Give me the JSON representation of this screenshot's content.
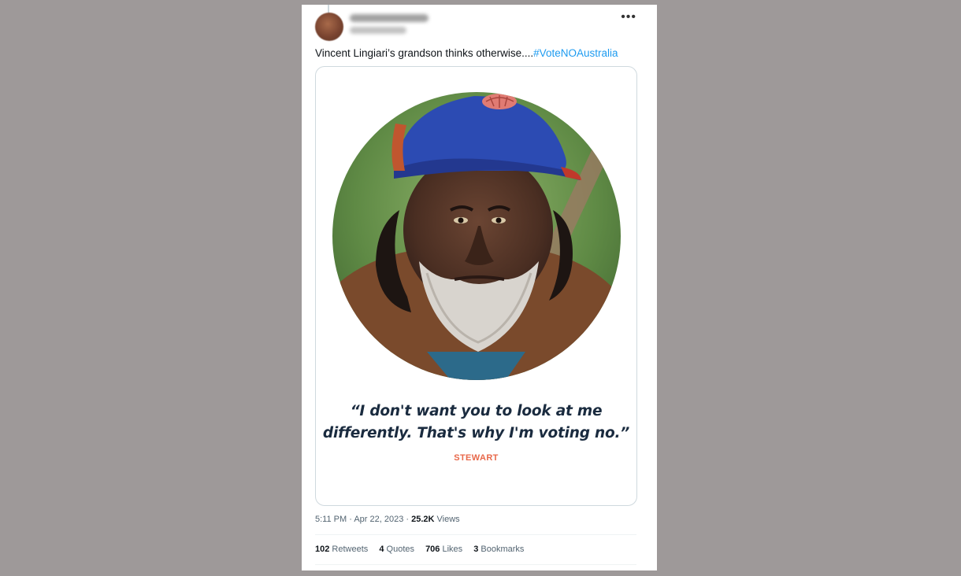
{
  "tweet": {
    "menu_icon": "more-horizontal-icon",
    "text": "Vincent Lingiari’s grandson thinks otherwise....",
    "hashtag": "#VoteNOAustralia"
  },
  "media": {
    "quote_line1": "“I don't want you to look at me",
    "quote_line2": "differently. That's why I'm voting no.”",
    "attribution": "STEWART"
  },
  "meta": {
    "time": "5:11 PM",
    "separator1": " · ",
    "date": "Apr 22, 2023",
    "separator2": " · ",
    "views_count": "25.2K",
    "views_label": " Views"
  },
  "stats": [
    {
      "count": "102",
      "label": " Retweets"
    },
    {
      "count": "4",
      "label": " Quotes"
    },
    {
      "count": "706",
      "label": " Likes"
    },
    {
      "count": "3",
      "label": " Bookmarks"
    }
  ],
  "colors": {
    "background": "#9e9999",
    "hashtag": "#1d9bf0",
    "quote": "#1a2b3f",
    "attribution": "#e8684a"
  }
}
